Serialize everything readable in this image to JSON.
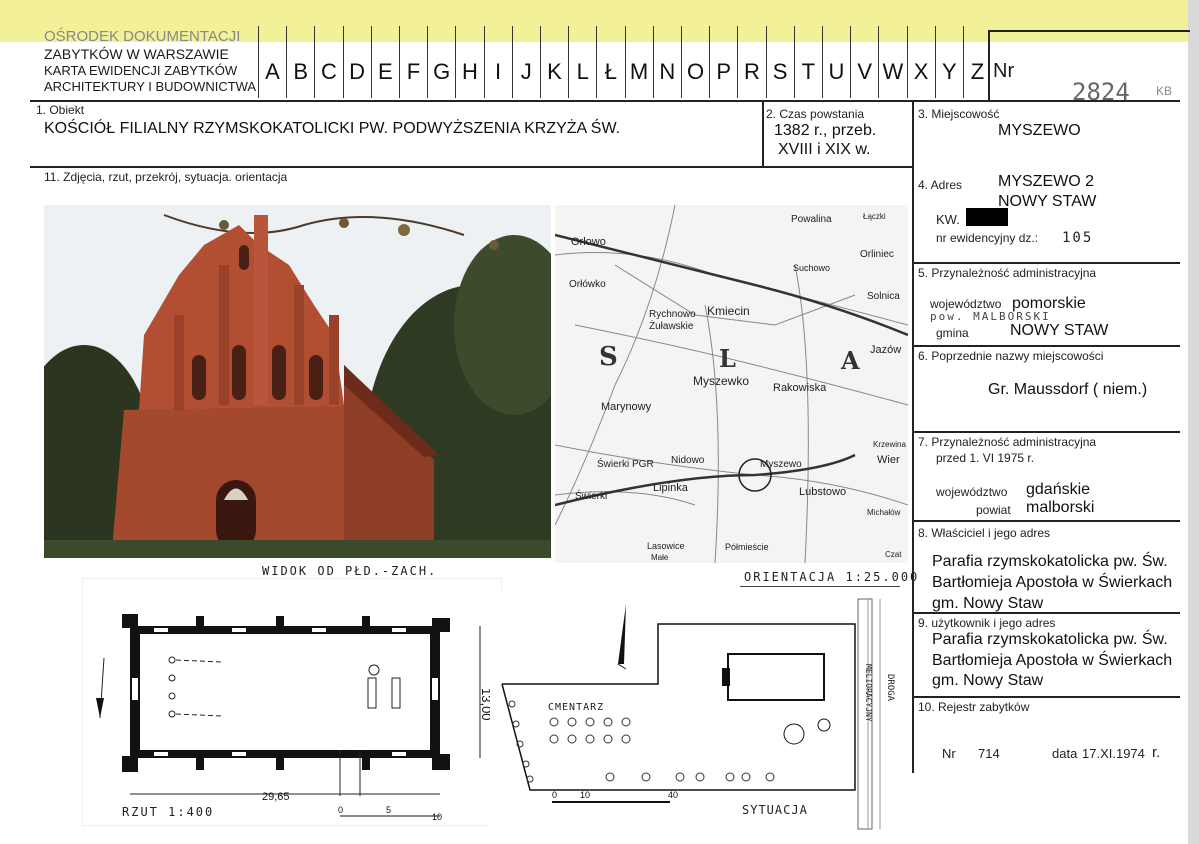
{
  "header": {
    "org_line1": "OŚRODEK DOKUMENTACJI",
    "org_line2": "ZABYTKÓW W WARSZAWIE",
    "card_line1": "KARTA EWIDENCJI ZABYTKÓW",
    "card_line2": "ARCHITEKTURY I BUDOWNICTWA",
    "letters": [
      "A",
      "B",
      "C",
      "D",
      "E",
      "F",
      "G",
      "H",
      "I",
      "J",
      "K",
      "L",
      "Ł",
      "M",
      "N",
      "O",
      "P",
      "R",
      "S",
      "T",
      "U",
      "V",
      "W",
      "X",
      "Y",
      "Z"
    ],
    "nr_label": "Nr",
    "nr_value": "2824",
    "initials": "KB"
  },
  "fields": {
    "obiekt_label": "1. Obiekt",
    "obiekt_value": "KOŚCIÓŁ FILIALNY RZYMSKOKATOLICKI  PW. PODWYŻSZENIA KRZYŻA ŚW.",
    "czas_label": "2. Czas powstania",
    "czas_line1": "1382  r., przeb.",
    "czas_line2": "XVIII i XIX w.",
    "miejscowosc_label": "3. Miejscowość",
    "miejscowosc_value": "MYSZEWO",
    "zdjecia_label": "11. Zdjęcia, rzut, przekrój, sytuacja. orientacja",
    "adres_label": "4. Adres",
    "adres_line1": "MYSZEWO 2",
    "adres_line2": "NOWY STAW",
    "kw_label": "KW.",
    "nr_ewid_label": "nr ewidencyjny dz.:",
    "nr_ewid_value": "105",
    "przynal_label": "5. Przynależność administracyjna",
    "woj_label": "województwo",
    "woj_value": "pomorskie",
    "powiat_hand": "pow. MALBORSKI",
    "gmina_label": "gmina",
    "gmina_value": "NOWY STAW",
    "poprzednie_label": "6. Poprzednie nazwy miejscowości",
    "poprzednie_value": "Gr. Maussdorf ( niem.)",
    "przynal_old_label": "7. Przynależność administracyjna",
    "przynal_old_sub": "przed 1. VI 1975 r.",
    "woj_old_label": "województwo",
    "woj_old_value": "gdańskie",
    "powiat_old_label": "powiat",
    "powiat_old_value": "malborski",
    "wlasciciel_label": "8. Właściciel i jego adres",
    "wlasciciel_l1": "Parafia rzymskokatolicka pw. Św.",
    "wlasciciel_l2": "Bartłomieja Apostoła w Świerkach",
    "wlasciciel_l3": "gm. Nowy Staw",
    "uzytkownik_label": "9. użytkownik i jego adres",
    "uzytkownik_l1": "Parafia rzymskokatolicka pw. Św.",
    "uzytkownik_l2": "Bartłomieja Apostoła w Świerkach",
    "uzytkownik_l3": "gm. Nowy Staw",
    "rejestr_label": "10. Rejestr zabytków",
    "rejestr_nr_label": "Nr",
    "rejestr_nr_value": "714",
    "rejestr_data_label": "data",
    "rejestr_data_value": "17.XI.1974",
    "rejestr_r": "r."
  },
  "captions": {
    "photo": "WIDOK  OD  PŁD.-ZACH.",
    "map": "ORIENTACJA 1:25.000",
    "plan": "RZUT  1:400",
    "plan_dim_len": "29,65",
    "plan_dim_width": "13,00",
    "plan_scale_0": "0",
    "plan_scale_5": "5",
    "plan_scale_10": "10",
    "situation": "SYTUACJA",
    "situation_cemetery": "CMENTARZ",
    "situation_scale_0": "0",
    "situation_scale_10": "10",
    "situation_scale_40": "40",
    "situation_road": "DROGA",
    "situation_road2": "MELIORACYJNY"
  },
  "map_labels": {
    "orlowo": "Orłowo",
    "orlowko": "Orłówko",
    "powalina": "Powalina",
    "laczki": "Łączki",
    "suchowo": "Suchowo",
    "orliniec": "Orliniec",
    "solnica": "Solnica",
    "rychnowo": "Rychnowo",
    "zulawskie": "Żuławskie",
    "kmiecin": "Kmiecin",
    "jazow": "Jazów",
    "myszewko": "Myszewko",
    "rakowiska": "Rakowiska",
    "marynowy": "Marynowy",
    "krzewina": "Krzewina",
    "swierki_pgr": "Świerki PGR",
    "nidowo": "Nidowo",
    "myszewo": "Myszewo",
    "wier": "Wier",
    "swierki": "Świerki",
    "lipinka": "Lipinka",
    "lubstowo": "Lubstowo",
    "michalow": "Michałów",
    "lasowice": "Lasowice",
    "lasowice2": "Małe",
    "polmiescie": "Półmieście",
    "czat": "Czat",
    "region_s": "S",
    "region_l": "L",
    "region_a": "A"
  },
  "colors": {
    "band": "#f3f09a",
    "brick": "#a4482e",
    "sky": "#eef1f4",
    "foliage": "#2f3a22"
  }
}
